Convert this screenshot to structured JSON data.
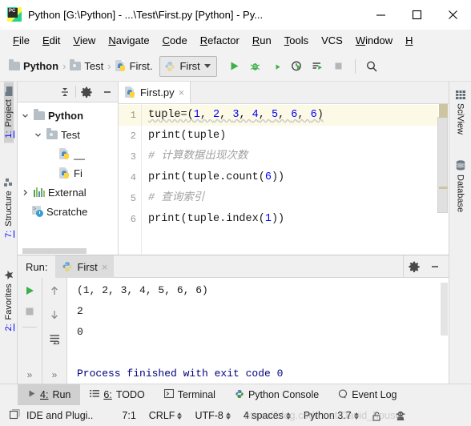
{
  "window": {
    "title": "Python [G:\\Python] - ...\\Test\\First.py [Python] - Py...",
    "app_icon": "pycharm-logo-icon",
    "minimize": "minimize-icon",
    "maximize": "maximize-icon",
    "close": "close-icon"
  },
  "menubar": {
    "items": [
      {
        "mnemonic": "F",
        "rest": "ile"
      },
      {
        "mnemonic": "E",
        "rest": "dit"
      },
      {
        "mnemonic": "V",
        "rest": "iew"
      },
      {
        "mnemonic": "N",
        "rest": "avigate"
      },
      {
        "mnemonic": "C",
        "rest": "ode"
      },
      {
        "mnemonic": "R",
        "rest": "efactor"
      },
      {
        "mnemonic": "R",
        "rest": "un"
      },
      {
        "mnemonic": "T",
        "rest": "ools"
      },
      {
        "mnemonic": "",
        "rest": "VCS"
      },
      {
        "mnemonic": "W",
        "rest": "indow"
      },
      {
        "mnemonic": "H",
        "rest": ""
      }
    ]
  },
  "navbar": {
    "crumbs": [
      {
        "label": "Python",
        "icon": "folder-icon"
      },
      {
        "label": "Test",
        "icon": "folder-source-icon"
      },
      {
        "label": "First.",
        "icon": "python-file-icon"
      }
    ],
    "separator": "›",
    "run_config": {
      "label": "First",
      "icon": "python-config-icon",
      "dropdown": "chevron-down-icon"
    },
    "actions": [
      {
        "name": "run-button",
        "color": "#3cb04a"
      },
      {
        "name": "debug-button",
        "color": "#3cb04a"
      },
      {
        "name": "run-with-coverage-button",
        "color": "#3a3a3a"
      },
      {
        "name": "profile-button",
        "color": "#3a3a3a"
      },
      {
        "name": "run-with-console-button",
        "color": "#3a3a3a"
      },
      {
        "name": "stop-button",
        "color": "#b0b0b0"
      },
      {
        "name": "search-everywhere-button",
        "color": "#3a3a3a"
      }
    ]
  },
  "left_tool_bars": [
    {
      "label_num": "1:",
      "label": " Project",
      "icon": "project-folder-icon",
      "selected": true
    },
    {
      "label_num": "7:",
      "label": " Structure",
      "icon": "structure-icon",
      "selected": false
    },
    {
      "label_num": "2:",
      "label": " Favorites",
      "icon": "star-icon",
      "selected": false
    }
  ],
  "right_tool_bars": [
    {
      "label": "SciView",
      "icon": "table-grid-icon"
    },
    {
      "label": "Database",
      "icon": "database-icon"
    }
  ],
  "project_panel": {
    "header_buttons": [
      {
        "name": "collapse-all-button",
        "icon": "collapse-all-icon"
      },
      {
        "name": "project-settings-button",
        "icon": "gear-icon"
      },
      {
        "name": "hide-panel-button",
        "icon": "minimize-icon"
      }
    ],
    "tree": [
      {
        "label": "Python",
        "icon": "folder-icon",
        "arrow": "expanded",
        "indent": 0,
        "bold": true
      },
      {
        "label": "Test",
        "icon": "folder-source-icon",
        "arrow": "expanded",
        "indent": 1,
        "bold": false
      },
      {
        "label": "__",
        "icon": "python-file-icon",
        "arrow": "none",
        "indent": 2,
        "bold": false
      },
      {
        "label": "Fi",
        "icon": "python-file-icon",
        "arrow": "none",
        "indent": 2,
        "bold": false
      },
      {
        "label": "External",
        "icon": "external-libraries-icon",
        "arrow": "collapsed",
        "indent": 0,
        "bold": false
      },
      {
        "label": "Scratche",
        "icon": "scratches-icon",
        "arrow": "none",
        "indent": 0,
        "bold": false
      }
    ]
  },
  "editor": {
    "tab": {
      "label": "First.py",
      "icon": "python-file-icon",
      "close": "×"
    },
    "caret_line": 1,
    "lines": [
      {
        "n": "1",
        "segments": [
          {
            "t": "tuple=",
            "c": "plain"
          },
          {
            "t": "(",
            "c": "plain"
          },
          {
            "t": "1",
            "c": "num"
          },
          {
            "t": ", ",
            "c": "plain"
          },
          {
            "t": "2",
            "c": "num"
          },
          {
            "t": ", ",
            "c": "plain"
          },
          {
            "t": "3",
            "c": "num"
          },
          {
            "t": ", ",
            "c": "plain"
          },
          {
            "t": "4",
            "c": "num"
          },
          {
            "t": ", ",
            "c": "plain"
          },
          {
            "t": "5",
            "c": "num"
          },
          {
            "t": ", ",
            "c": "plain"
          },
          {
            "t": "6",
            "c": "num"
          },
          {
            "t": ", ",
            "c": "plain"
          },
          {
            "t": "6",
            "c": "num"
          },
          {
            "t": ")",
            "c": "plain"
          }
        ],
        "text": "tuple=(1, 2, 3, 4, 5, 6, 6)"
      },
      {
        "n": "2",
        "segments": [
          {
            "t": "print(tuple)",
            "c": "plain"
          }
        ],
        "text": "print(tuple)"
      },
      {
        "n": "3",
        "segments": [
          {
            "t": "# 计算数据出现次数",
            "c": "cmt"
          }
        ],
        "text": "# 计算数据出现次数"
      },
      {
        "n": "4",
        "segments": [
          {
            "t": "print(tuple.count(",
            "c": "plain"
          },
          {
            "t": "6",
            "c": "num"
          },
          {
            "t": "))",
            "c": "plain"
          }
        ],
        "text": "print(tuple.count(6))"
      },
      {
        "n": "5",
        "segments": [
          {
            "t": "# 查询索引",
            "c": "cmt"
          }
        ],
        "text": "# 查询索引"
      },
      {
        "n": "6",
        "segments": [
          {
            "t": "print(tuple.index(",
            "c": "plain"
          },
          {
            "t": "1",
            "c": "num"
          },
          {
            "t": "))",
            "c": "plain"
          }
        ],
        "text": "print(tuple.index(1))"
      }
    ]
  },
  "run_panel": {
    "label": "Run:",
    "tab": {
      "label": "First",
      "icon": "python-config-icon",
      "close": "×"
    },
    "header_buttons": [
      {
        "name": "run-settings-button",
        "icon": "gear-icon"
      },
      {
        "name": "hide-run-panel-button",
        "icon": "minimize-icon"
      }
    ],
    "gutter_buttons": [
      {
        "name": "rerun-button",
        "icon": "run-icon"
      },
      {
        "name": "stop-process-button",
        "icon": "stop-icon"
      },
      {
        "name": "more-actions-button",
        "icon": "chevrons-right-icon"
      }
    ],
    "gutter2_buttons": [
      {
        "name": "previous-occurrence-button",
        "icon": "arrow-up-icon"
      },
      {
        "name": "next-occurrence-button",
        "icon": "arrow-down-icon"
      },
      {
        "name": "soft-wrap-button",
        "icon": "soft-wrap-icon"
      },
      {
        "name": "more-actions-button-2",
        "icon": "chevrons-right-icon"
      }
    ],
    "output": [
      {
        "text": "(1, 2, 3, 4, 5, 6, 6)",
        "color": "black"
      },
      {
        "text": "2",
        "color": "black"
      },
      {
        "text": "0",
        "color": "black"
      },
      {
        "text": "",
        "color": "black"
      },
      {
        "text": "Process finished with exit code 0",
        "color": "blue"
      }
    ]
  },
  "bottom_tool_bar": [
    {
      "num": "4:",
      "label": " Run",
      "icon": "run-icon",
      "selected": true
    },
    {
      "num": "6:",
      "label": " TODO",
      "icon": "todo-list-icon",
      "selected": false
    },
    {
      "num": "",
      "label": "Terminal",
      "icon": "terminal-icon",
      "selected": false
    },
    {
      "num": "",
      "label": "Python Console",
      "icon": "python-console-icon",
      "selected": false
    },
    {
      "num": "",
      "label": "Event Log",
      "icon": "event-log-icon",
      "selected": false
    }
  ],
  "statusbar": {
    "message": "IDE and Plugi..",
    "message_icon": "ide-notification-icon",
    "caret_position": "7:1",
    "line_separator": "CRLF",
    "encoding": "UTF-8",
    "indent": "4 spaces",
    "interpreter": "Python 3.7",
    "lock_icon": "unlocked-icon",
    "inspector_icon": "hector-inspector-icon",
    "watermark": "https://blog.csdn.net/David_house"
  },
  "colors": {
    "accent_green": "#3cb04a",
    "number_blue": "#0000ff",
    "console_blue": "#000080",
    "caret_row": "#fcf9e6",
    "panel_bg": "#f0f0f0",
    "selected_tab": "#d0d0d0"
  }
}
